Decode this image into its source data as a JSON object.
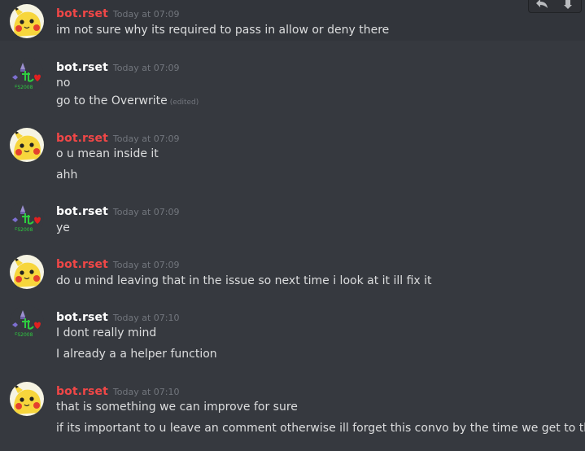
{
  "toolbar": {
    "reply_icon": "reply-icon",
    "more_icon": "more-icon"
  },
  "messages": [
    {
      "author": "bot.rset",
      "author_color": "#f04747",
      "avatar": "pikachu",
      "time": "Today at 07:09",
      "lines": [
        "im not sure why its required to pass in allow or deny there"
      ]
    },
    {
      "author": "bot.rset",
      "author_color": "#ffffff",
      "avatar": "pixel-art",
      "time": "Today at 07:09",
      "lines": [
        "no",
        "go to the Overwrite"
      ],
      "edited": "(edited)"
    },
    {
      "author": "bot.rset",
      "author_color": "#f04747",
      "avatar": "pikachu",
      "time": "Today at 07:09",
      "lines": [
        "o u mean inside it",
        "ahh"
      ]
    },
    {
      "author": "bot.rset",
      "author_color": "#ffffff",
      "avatar": "pixel-art",
      "time": "Today at 07:09",
      "lines": [
        "ye"
      ]
    },
    {
      "author": "bot.rset",
      "author_color": "#f04747",
      "avatar": "pikachu",
      "time": "Today at 07:09",
      "lines": [
        "do u mind leaving that in the issue so next time i look at it ill fix it"
      ]
    },
    {
      "author": "bot.rset",
      "author_color": "#ffffff",
      "avatar": "pixel-art",
      "time": "Today at 07:10",
      "lines": [
        "I dont really mind",
        "I already a a helper function"
      ]
    },
    {
      "author": "bot.rset",
      "author_color": "#f04747",
      "avatar": "pikachu",
      "time": "Today at 07:10",
      "lines": [
        "that is something we can improve for sure",
        "if its important to u leave an comment otherwise ill forget this convo by the time we get to that"
      ]
    }
  ]
}
